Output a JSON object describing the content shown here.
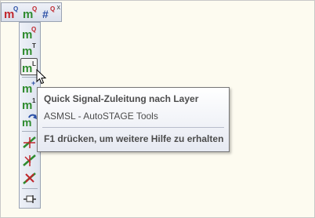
{
  "toolbar_h": {
    "buttons": [
      {
        "glyph": "m",
        "badge": "Q",
        "icon": "measure-q-icon"
      },
      {
        "glyph": "m",
        "badge": "Q",
        "icon": "measure-q-alt-icon"
      },
      {
        "glyph": "#",
        "badge": "Q",
        "icon": "hash-q-icon"
      }
    ],
    "close": "x"
  },
  "toolbar_v": {
    "buttons": [
      {
        "glyph": "m",
        "badge": "Q",
        "icon": "measure-q-icon"
      },
      {
        "glyph": "m",
        "badge": "T",
        "icon": "measure-t-icon"
      },
      {
        "glyph": "m",
        "badge": "L",
        "icon": "measure-layer-icon",
        "active": true
      },
      {
        "glyph": "m",
        "badge": "+",
        "icon": "measure-add-icon"
      },
      {
        "glyph": "m",
        "badge": "1",
        "icon": "measure-one-icon"
      },
      {
        "glyph": "m",
        "badge": "↷",
        "icon": "measure-rotate-icon"
      },
      {
        "glyph": "",
        "badge": "",
        "icon": "line-edit-icon"
      },
      {
        "glyph": "",
        "badge": "",
        "icon": "line-edit-2-icon"
      },
      {
        "glyph": "",
        "badge": "",
        "icon": "line-delete-icon"
      },
      {
        "glyph": "",
        "badge": "",
        "icon": "pin-icon"
      }
    ]
  },
  "tooltip": {
    "title": "Quick Signal-Zuleitung nach Layer",
    "subtitle": "ASMSL - AutoSTAGE Tools",
    "help": "F1 drücken, um weitere Hilfe zu erhalten"
  },
  "colors": {
    "background": "#fdfbf0",
    "toolbar": "#dde3ee",
    "green": "#2e8b2e",
    "red": "#c0262c",
    "blue": "#2a4fa6"
  }
}
